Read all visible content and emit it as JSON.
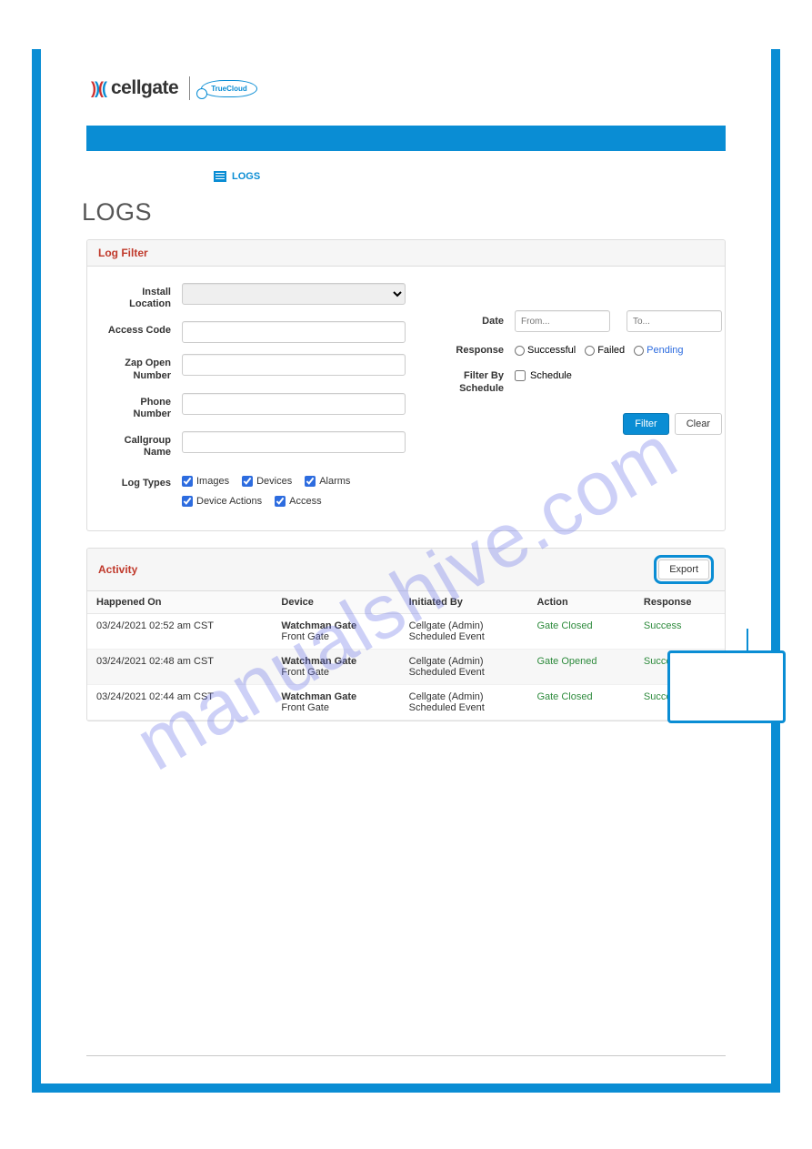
{
  "logo": {
    "brand": "cellgate",
    "cloud": "TrueCloud"
  },
  "breadcrumb": {
    "label": "LOGS"
  },
  "pageTitle": "LOGS",
  "filterPanel": {
    "title": "Log Filter",
    "labels": {
      "installLocation": "Install Location",
      "accessCode": "Access Code",
      "zapOpenNumber": "Zap Open Number",
      "phoneNumber": "Phone Number",
      "callgroupName": "Callgroup Name",
      "logTypes": "Log Types",
      "date": "Date",
      "response": "Response",
      "filterBySchedule": "Filter By Schedule"
    },
    "placeholders": {
      "from": "From...",
      "to": "To..."
    },
    "logTypes": {
      "images": "Images",
      "devices": "Devices",
      "alarms": "Alarms",
      "deviceActions": "Device Actions",
      "access": "Access"
    },
    "responseOptions": {
      "successful": "Successful",
      "failed": "Failed",
      "pending": "Pending"
    },
    "scheduleOption": "Schedule",
    "buttons": {
      "filter": "Filter",
      "clear": "Clear"
    }
  },
  "activityPanel": {
    "title": "Activity",
    "export": "Export",
    "columns": {
      "happenedOn": "Happened On",
      "device": "Device",
      "initiatedBy": "Initiated By",
      "action": "Action",
      "response": "Response"
    },
    "rows": [
      {
        "time": "03/24/2021 02:52 am CST",
        "deviceName": "Watchman Gate",
        "deviceSub": "Front Gate",
        "initName": "Cellgate (Admin)",
        "initSub": "Scheduled Event",
        "action": "Gate Closed",
        "response": "Success"
      },
      {
        "time": "03/24/2021 02:48 am CST",
        "deviceName": "Watchman Gate",
        "deviceSub": "Front Gate",
        "initName": "Cellgate (Admin)",
        "initSub": "Scheduled Event",
        "action": "Gate Opened",
        "response": "Success"
      },
      {
        "time": "03/24/2021 02:44 am CST",
        "deviceName": "Watchman Gate",
        "deviceSub": "Front Gate",
        "initName": "Cellgate (Admin)",
        "initSub": "Scheduled Event",
        "action": "Gate Closed",
        "response": "Success"
      }
    ]
  },
  "watermark": "manualshive.com"
}
